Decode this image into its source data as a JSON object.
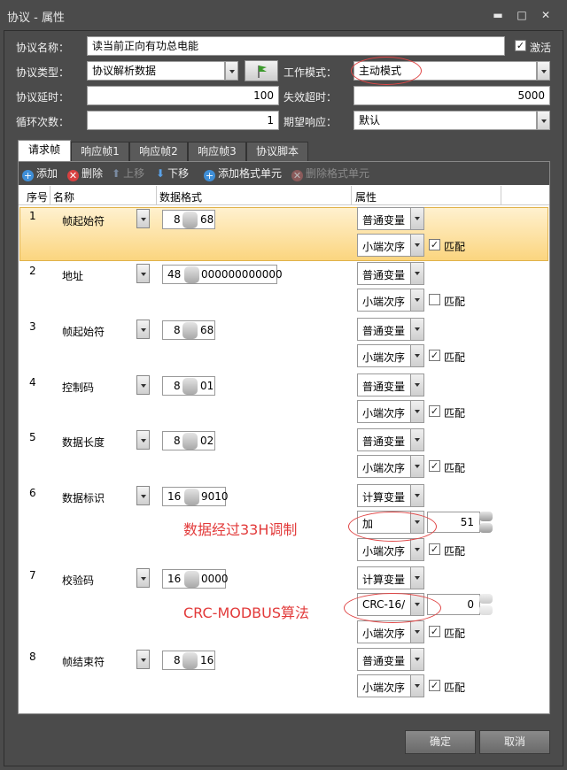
{
  "window": {
    "title": "协议 - 属性"
  },
  "form": {
    "name_label": "协议名称：",
    "name_value": "读当前正向有功总电能",
    "activate_label": "激活",
    "activate_checked": true,
    "type_label": "协议类型：",
    "type_value": "协议解析数据",
    "mode_label": "工作模式：",
    "mode_value": "主动模式",
    "delay_label": "协议延时：",
    "delay_value": "100",
    "timeout_label": "失效超时：",
    "timeout_value": "5000",
    "loop_label": "循环次数：",
    "loop_value": "1",
    "response_label": "期望响应：",
    "response_value": "默认"
  },
  "tabs": [
    {
      "label": "请求帧",
      "active": true
    },
    {
      "label": "响应帧1",
      "active": false
    },
    {
      "label": "响应帧2",
      "active": false
    },
    {
      "label": "响应帧3",
      "active": false
    },
    {
      "label": "协议脚本",
      "active": false
    }
  ],
  "toolbar": {
    "add": "添加",
    "delete": "删除",
    "up": "上移",
    "down": "下移",
    "add_unit": "添加格式单元",
    "del_unit": "删除格式单元"
  },
  "columns": {
    "index": "序号",
    "name": "名称",
    "format": "数据格式",
    "props": "属性"
  },
  "rows": [
    {
      "index": "1",
      "name": "帧起始符",
      "len": "8",
      "val": "68",
      "var": "普通变量",
      "order": "小端次序",
      "match": "匹配",
      "matched": true
    },
    {
      "index": "2",
      "name": "地址",
      "len": "48",
      "val": "000000000000",
      "var": "普通变量",
      "order": "小端次序",
      "match": "匹配",
      "matched": false
    },
    {
      "index": "3",
      "name": "帧起始符",
      "len": "8",
      "val": "68",
      "var": "普通变量",
      "order": "小端次序",
      "match": "匹配",
      "matched": true
    },
    {
      "index": "4",
      "name": "控制码",
      "len": "8",
      "val": "01",
      "var": "普通变量",
      "order": "小端次序",
      "match": "匹配",
      "matched": true
    },
    {
      "index": "5",
      "name": "数据长度",
      "len": "8",
      "val": "02",
      "var": "普通变量",
      "order": "小端次序",
      "match": "匹配",
      "matched": true
    },
    {
      "index": "6",
      "name": "数据标识",
      "len": "16",
      "val": "9010",
      "var": "计算变量",
      "op": "加",
      "op_value": "51",
      "order": "小端次序",
      "match": "匹配",
      "matched": true
    },
    {
      "index": "7",
      "name": "校验码",
      "len": "16",
      "val": "0000",
      "var": "计算变量",
      "op": "CRC-16/",
      "op_value": "0",
      "order": "小端次序",
      "match": "匹配",
      "matched": true
    },
    {
      "index": "8",
      "name": "帧结束符",
      "len": "8",
      "val": "16",
      "var": "普通变量",
      "order": "小端次序",
      "match": "匹配",
      "matched": true
    }
  ],
  "annotations": {
    "a1": "数据经过33H调制",
    "a2": "CRC-MODBUS算法",
    "color": "#e23a3a"
  },
  "buttons": {
    "ok": "确定",
    "cancel": "取消"
  }
}
